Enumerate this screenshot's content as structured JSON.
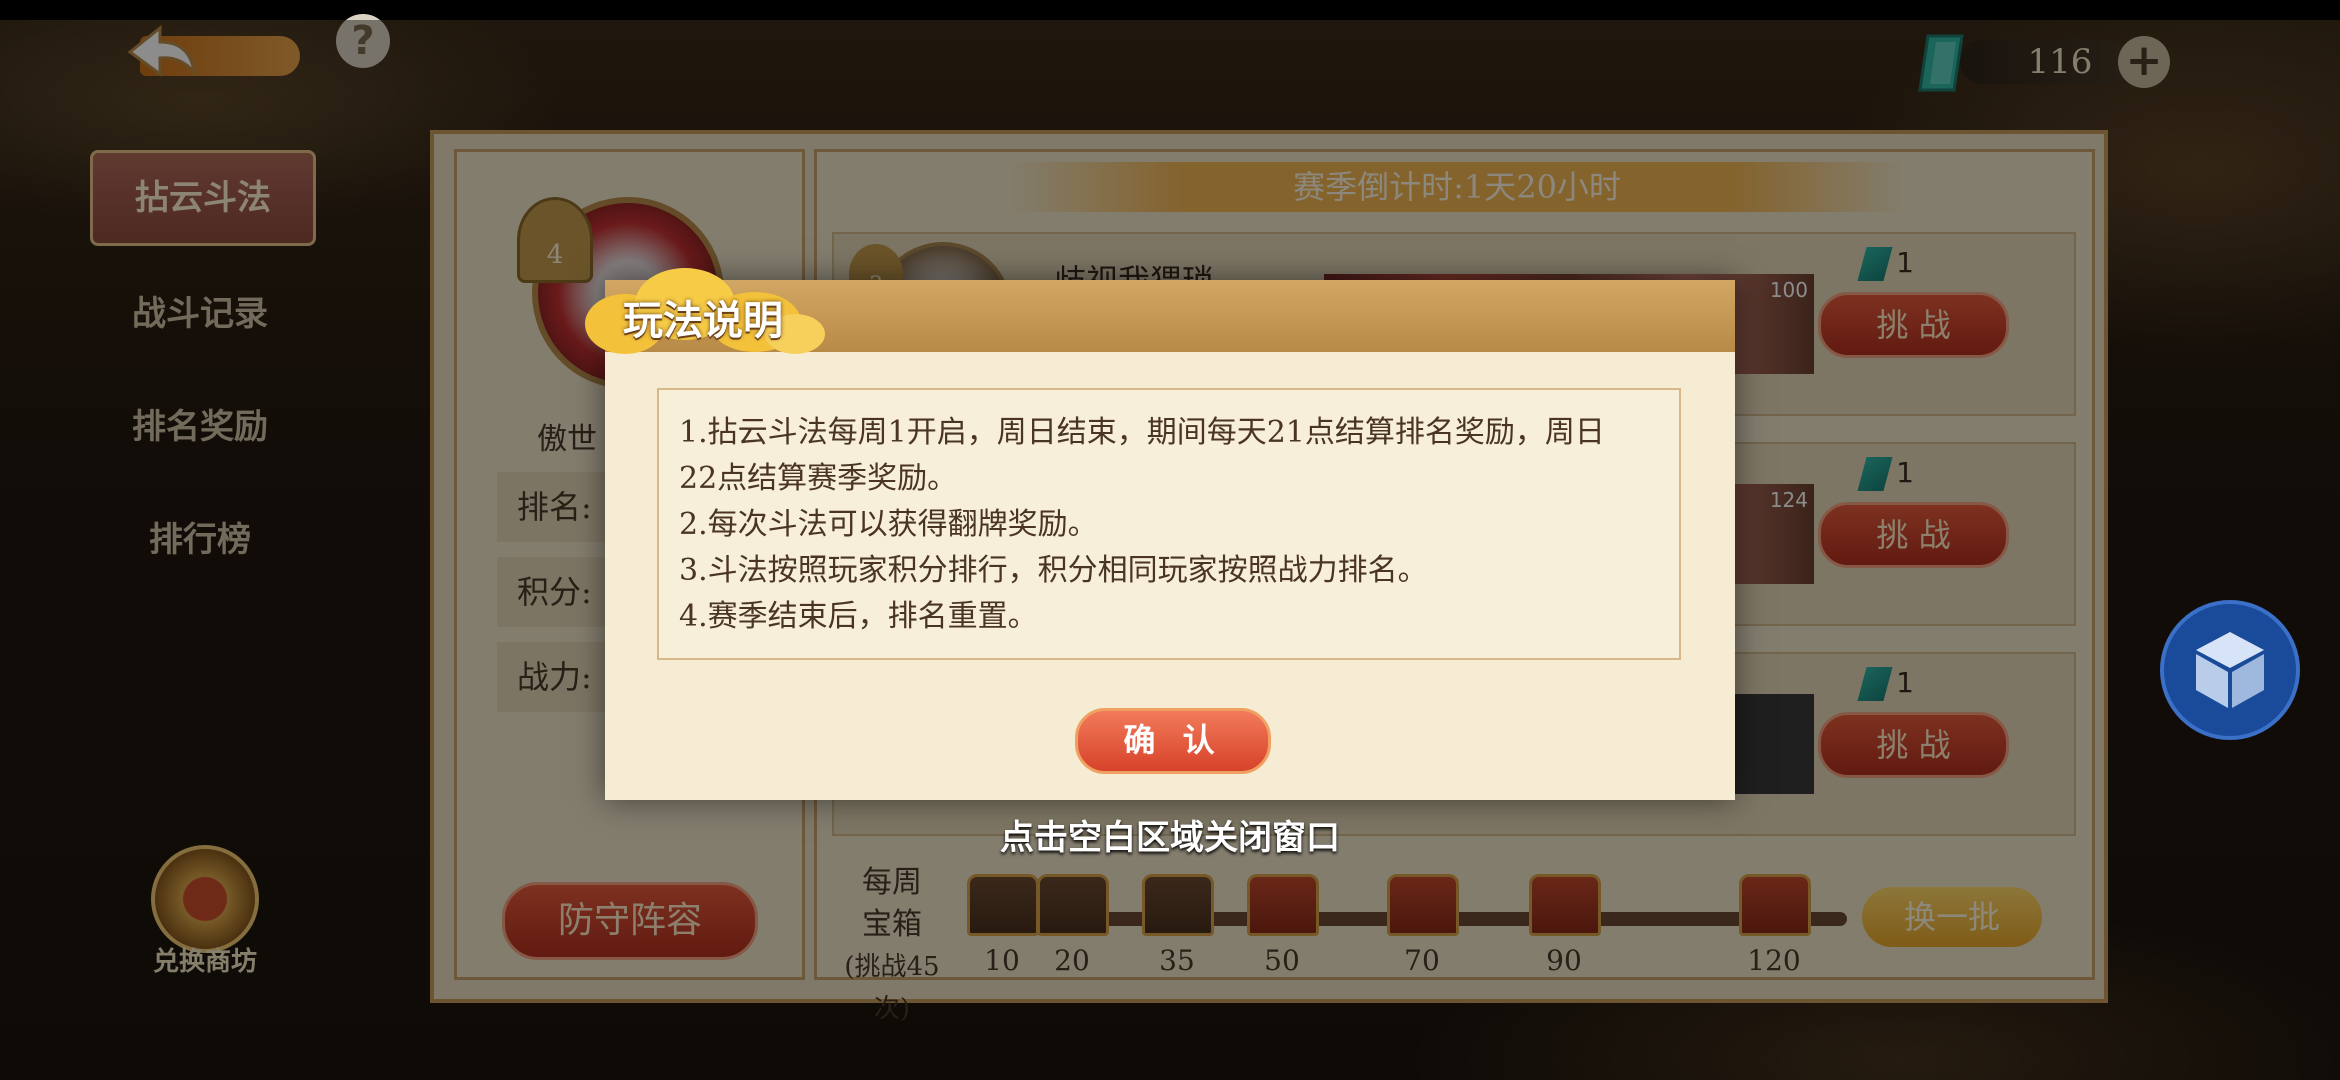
{
  "currency": {
    "value": "116",
    "icon": "jade-ticket-icon"
  },
  "sidebar": {
    "items": [
      {
        "label": "拈云斗法",
        "active": true
      },
      {
        "label": "战斗记录",
        "active": false
      },
      {
        "label": "排名奖励",
        "active": false
      },
      {
        "label": "排行榜",
        "active": false
      }
    ],
    "shop_label": "兑换商坊"
  },
  "player": {
    "rank_badge": "4",
    "name": "傲世",
    "rank_label": "排名: 1",
    "score_label": "积分: 1",
    "power_label": "战力: 1",
    "defense_button": "防守阵容"
  },
  "season": {
    "countdown": "赛季倒计时:1天20小时"
  },
  "opponents": [
    {
      "rank": "3",
      "name": "歧视我猥琐",
      "level": "100",
      "cost": "1",
      "button": "挑 战"
    },
    {
      "rank": "",
      "name": "",
      "level": "124",
      "cost": "1",
      "button": "挑 战"
    },
    {
      "rank": "",
      "name": "",
      "level": "",
      "cost": "1",
      "button": "挑 战"
    }
  ],
  "weekly": {
    "label_line1": "每周",
    "label_line2": "宝箱",
    "label_line3": "(挑战45次)",
    "milestones": [
      "10",
      "20",
      "35",
      "50",
      "70",
      "90",
      "120"
    ],
    "refresh_button": "换一批"
  },
  "dialog": {
    "title": "玩法说明",
    "rules": [
      "1.拈云斗法每周1开启，周日结束，期间每天21点结算排名奖励，周日",
      "22点结算赛季奖励。",
      "2.每次斗法可以获得翻牌奖励。",
      "3.斗法按照玩家积分排行，积分相同玩家按照战力排名。",
      "4.赛季结束后，排名重置。"
    ],
    "confirm": "确 认",
    "close_hint": "点击空白区域关闭窗口"
  },
  "colors": {
    "accent_red": "#d7432a",
    "header_gold": "#c89a55",
    "panel_bg": "#f6ecd3",
    "text_brown": "#4a3524"
  }
}
